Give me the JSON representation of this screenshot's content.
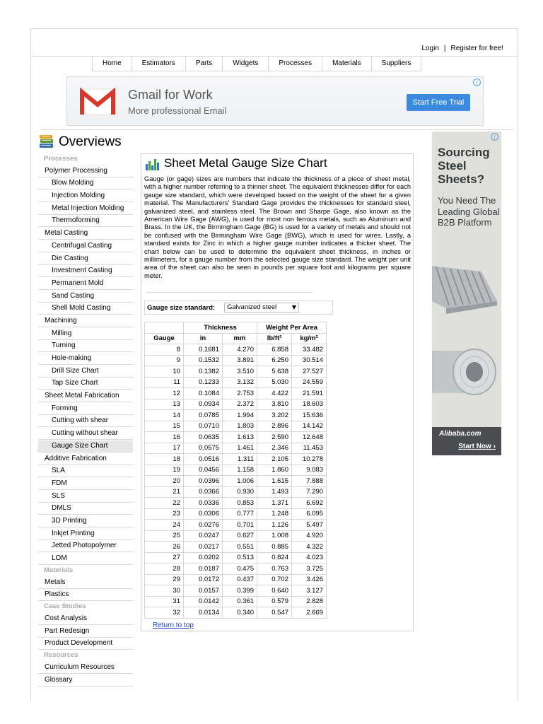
{
  "header": {
    "login": "Login",
    "separator": "|",
    "register": "Register for free!"
  },
  "nav": [
    "Home",
    "Estimators",
    "Parts",
    "Widgets",
    "Processes",
    "Materials",
    "Suppliers"
  ],
  "banner_ad": {
    "title": "Gmail for Work",
    "subtitle": "More professional Email",
    "button": "Start Free Trial",
    "info": "i"
  },
  "overviews_title": "Overviews",
  "sidebar": [
    {
      "type": "section",
      "label": "Processes"
    },
    {
      "type": "item",
      "label": "Polymer Processing"
    },
    {
      "type": "sub",
      "label": "Blow Molding"
    },
    {
      "type": "sub",
      "label": "Injection Molding"
    },
    {
      "type": "sub",
      "label": "Metal Injection Molding"
    },
    {
      "type": "sub",
      "label": "Thermoforming"
    },
    {
      "type": "item",
      "label": "Metal Casting"
    },
    {
      "type": "sub",
      "label": "Centrifugal Casting"
    },
    {
      "type": "sub",
      "label": "Die Casting"
    },
    {
      "type": "sub",
      "label": "Investment Casting"
    },
    {
      "type": "sub",
      "label": "Permanent Mold"
    },
    {
      "type": "sub",
      "label": "Sand Casting"
    },
    {
      "type": "sub",
      "label": "Shell Mold Casting"
    },
    {
      "type": "item",
      "label": "Machining"
    },
    {
      "type": "sub",
      "label": "Milling"
    },
    {
      "type": "sub",
      "label": "Turning"
    },
    {
      "type": "sub",
      "label": "Hole-making"
    },
    {
      "type": "sub",
      "label": "Drill Size Chart"
    },
    {
      "type": "sub",
      "label": "Tap Size Chart"
    },
    {
      "type": "item",
      "label": "Sheet Metal Fabrication"
    },
    {
      "type": "sub",
      "label": "Forming"
    },
    {
      "type": "sub",
      "label": "Cutting with shear"
    },
    {
      "type": "sub",
      "label": "Cutting without shear"
    },
    {
      "type": "sub",
      "label": "Gauge Size Chart",
      "active": true
    },
    {
      "type": "item",
      "label": "Additive Fabrication"
    },
    {
      "type": "sub",
      "label": "SLA"
    },
    {
      "type": "sub",
      "label": "FDM"
    },
    {
      "type": "sub",
      "label": "SLS"
    },
    {
      "type": "sub",
      "label": "DMLS"
    },
    {
      "type": "sub",
      "label": "3D Printing"
    },
    {
      "type": "sub",
      "label": "Inkjet Printing"
    },
    {
      "type": "sub",
      "label": "Jetted Photopolymer"
    },
    {
      "type": "sub",
      "label": "LOM"
    },
    {
      "type": "section",
      "label": "Materials"
    },
    {
      "type": "item",
      "label": "Metals"
    },
    {
      "type": "item",
      "label": "Plastics"
    },
    {
      "type": "section",
      "label": "Case Studies"
    },
    {
      "type": "item",
      "label": "Cost Analysis"
    },
    {
      "type": "item",
      "label": "Part Redesign"
    },
    {
      "type": "item",
      "label": "Product Development"
    },
    {
      "type": "section",
      "label": "Resources"
    },
    {
      "type": "item",
      "label": "Curriculum Resources"
    },
    {
      "type": "item",
      "label": "Glossary"
    }
  ],
  "main": {
    "title": "Sheet Metal Gauge Size Chart",
    "description": "Gauge (or gage) sizes are numbers that indicate the thickness of a piece of sheet metal, with a higher number referring to a thinner sheet. The equivalent thicknesses differ for each gauge size standard, which were developed based on the weight of the sheet for a given material. The Manufacturers' Standard Gage provides the thicknesses for standard steel, galvanized steel, and stainless steel. The Brown and Sharpe Gage, also known as the American Wire Gage (AWG), is used for most non ferrous metals, such as Aluminum and Brass. In the UK, the Birmingham Gage (BG) is used for a variety of metals and should not be confused with the Birmingham Wire Gage (BWG), which is used for wires. Lastly, a standard exists for Zinc in which a higher gauge number indicates a thicker sheet. The chart below can be used to determine the equivalent sheet thickness, in inches or millimeters, for a gauge number from the selected gauge size standard. The weight per unit area of the sheet can also be seen in pounds per square foot and kilograms per square meter.",
    "gauge_standard_label": "Gauge size standard:",
    "gauge_standard_value": "Galvanized steel",
    "dropdown_arrow": "▼",
    "return_link": "Return to top"
  },
  "table": {
    "group_headers": [
      "Thickness",
      "Weight Per Area"
    ],
    "columns": [
      "Gauge",
      "in",
      "mm",
      "lb/ft²",
      "kg/m²"
    ],
    "rows": [
      [
        "8",
        "0.1681",
        "4.270",
        "6.858",
        "33.482"
      ],
      [
        "9",
        "0.1532",
        "3.891",
        "6.250",
        "30.514"
      ],
      [
        "10",
        "0.1382",
        "3.510",
        "5.638",
        "27.527"
      ],
      [
        "11",
        "0.1233",
        "3.132",
        "5.030",
        "24.559"
      ],
      [
        "12",
        "0.1084",
        "2.753",
        "4.422",
        "21.591"
      ],
      [
        "13",
        "0.0934",
        "2.372",
        "3.810",
        "18.603"
      ],
      [
        "14",
        "0.0785",
        "1.994",
        "3.202",
        "15.636"
      ],
      [
        "15",
        "0.0710",
        "1.803",
        "2.896",
        "14.142"
      ],
      [
        "16",
        "0.0635",
        "1.613",
        "2.590",
        "12.648"
      ],
      [
        "17",
        "0.0575",
        "1.461",
        "2.346",
        "11.453"
      ],
      [
        "18",
        "0.0516",
        "1.311",
        "2.105",
        "10.278"
      ],
      [
        "19",
        "0.0456",
        "1.158",
        "1.860",
        "9.083"
      ],
      [
        "20",
        "0.0396",
        "1.006",
        "1.615",
        "7.888"
      ],
      [
        "21",
        "0.0366",
        "0.930",
        "1.493",
        "7.290"
      ],
      [
        "22",
        "0.0336",
        "0.853",
        "1.371",
        "6.692"
      ],
      [
        "23",
        "0.0306",
        "0.777",
        "1.248",
        "6.095"
      ],
      [
        "24",
        "0.0276",
        "0.701",
        "1.126",
        "5.497"
      ],
      [
        "25",
        "0.0247",
        "0.627",
        "1.008",
        "4.920"
      ],
      [
        "26",
        "0.0217",
        "0.551",
        "0.885",
        "4.322"
      ],
      [
        "27",
        "0.0202",
        "0.513",
        "0.824",
        "4.023"
      ],
      [
        "28",
        "0.0187",
        "0.475",
        "0.763",
        "3.725"
      ],
      [
        "29",
        "0.0172",
        "0.437",
        "0.702",
        "3.426"
      ],
      [
        "30",
        "0.0157",
        "0.399",
        "0.640",
        "3.127"
      ],
      [
        "31",
        "0.0142",
        "0.361",
        "0.579",
        "2.828"
      ],
      [
        "32",
        "0.0134",
        "0.340",
        "0.547",
        "2.669"
      ]
    ]
  },
  "side_ad": {
    "title": "Sourcing Steel Sheets?",
    "subtitle": "You Need The Leading Global B2B Platform",
    "brand": "Alibaba.com",
    "cta": "Start Now ›",
    "info": "i"
  },
  "colors": {
    "link": "#1a3fd6",
    "button": "#3a8be0",
    "gmail_red": "#d6382b",
    "border": "#d6d6d6"
  }
}
